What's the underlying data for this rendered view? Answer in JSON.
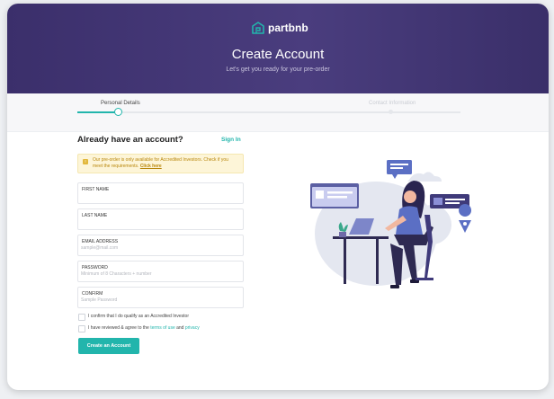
{
  "brand": {
    "name": "partbnb",
    "color": "#3b2f6b",
    "accent": "#22b5ac"
  },
  "header": {
    "title": "Create Account",
    "subtitle": "Let's get you ready for your pre-order"
  },
  "steps": [
    {
      "label": "Personal Details",
      "state": "active"
    },
    {
      "label": "Contact Information",
      "state": "inactive"
    }
  ],
  "form": {
    "title": "Already have an account?",
    "signin_label": "Sign In",
    "notice": {
      "text": "Our pre-order is only available for Accredited Investors. Check if you meet the requirements.",
      "link": "Click here"
    },
    "fields": [
      {
        "label": "FIRST NAME",
        "placeholder": ""
      },
      {
        "label": "LAST NAME",
        "placeholder": ""
      },
      {
        "label": "EMAIL ADDRESS",
        "placeholder": "sample@mail.com"
      },
      {
        "label": "PASSWORD",
        "placeholder": "Minimum of 8 Characters + number"
      },
      {
        "label": "CONFIRM",
        "placeholder": "Sample Password"
      }
    ],
    "checkboxes": {
      "investor": "I confirm that I do qualify as an Accredited Investor",
      "terms_prefix": "I have reviewed & agree to the",
      "terms_link": "terms of use",
      "terms_and": "and",
      "privacy_link": "privacy"
    },
    "submit_label": "Create an Account"
  },
  "illustration": {
    "icon": "person-working-on-laptop-illustration"
  }
}
